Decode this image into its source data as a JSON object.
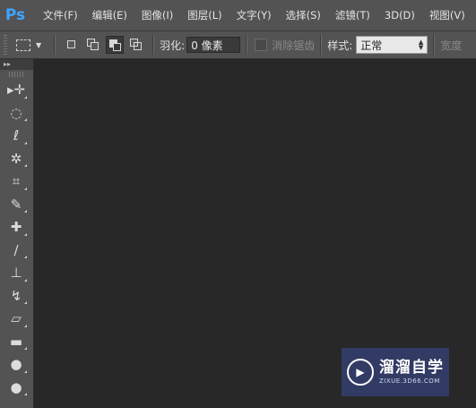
{
  "app": {
    "logo": "Ps"
  },
  "menu": [
    "文件(F)",
    "编辑(E)",
    "图像(I)",
    "图层(L)",
    "文字(Y)",
    "选择(S)",
    "滤镜(T)",
    "3D(D)",
    "视图(V)"
  ],
  "options": {
    "feather_label": "羽化:",
    "feather_value": "0 像素",
    "antialias_label": "消除锯齿",
    "style_label": "样式:",
    "style_value": "正常",
    "width_label": "宽度"
  },
  "toolbar": {
    "collapse": "▸▸",
    "tools": [
      {
        "name": "move-tool-icon",
        "glyph": "▸✛"
      },
      {
        "name": "elliptical-marquee-icon",
        "glyph": "◌"
      },
      {
        "name": "lasso-icon",
        "glyph": "ℓ"
      },
      {
        "name": "magic-wand-icon",
        "glyph": "✲"
      },
      {
        "name": "crop-icon",
        "glyph": "⌗"
      },
      {
        "name": "eyedropper-icon",
        "glyph": "✎"
      },
      {
        "name": "healing-brush-icon",
        "glyph": "✚"
      },
      {
        "name": "brush-icon",
        "glyph": "∕"
      },
      {
        "name": "clone-stamp-icon",
        "glyph": "⊥"
      },
      {
        "name": "history-brush-icon",
        "glyph": "↯"
      },
      {
        "name": "eraser-icon",
        "glyph": "▱"
      },
      {
        "name": "gradient-icon",
        "glyph": "▬"
      },
      {
        "name": "blur-icon",
        "glyph": "●"
      },
      {
        "name": "dodge-icon",
        "glyph": "●"
      }
    ]
  },
  "watermark": {
    "title": "溜溜自学",
    "subtitle": "ZIXUE.3D66.COM"
  },
  "colors": {
    "panel": "#535353",
    "canvas": "#282828",
    "accent": "#3da6ff"
  }
}
